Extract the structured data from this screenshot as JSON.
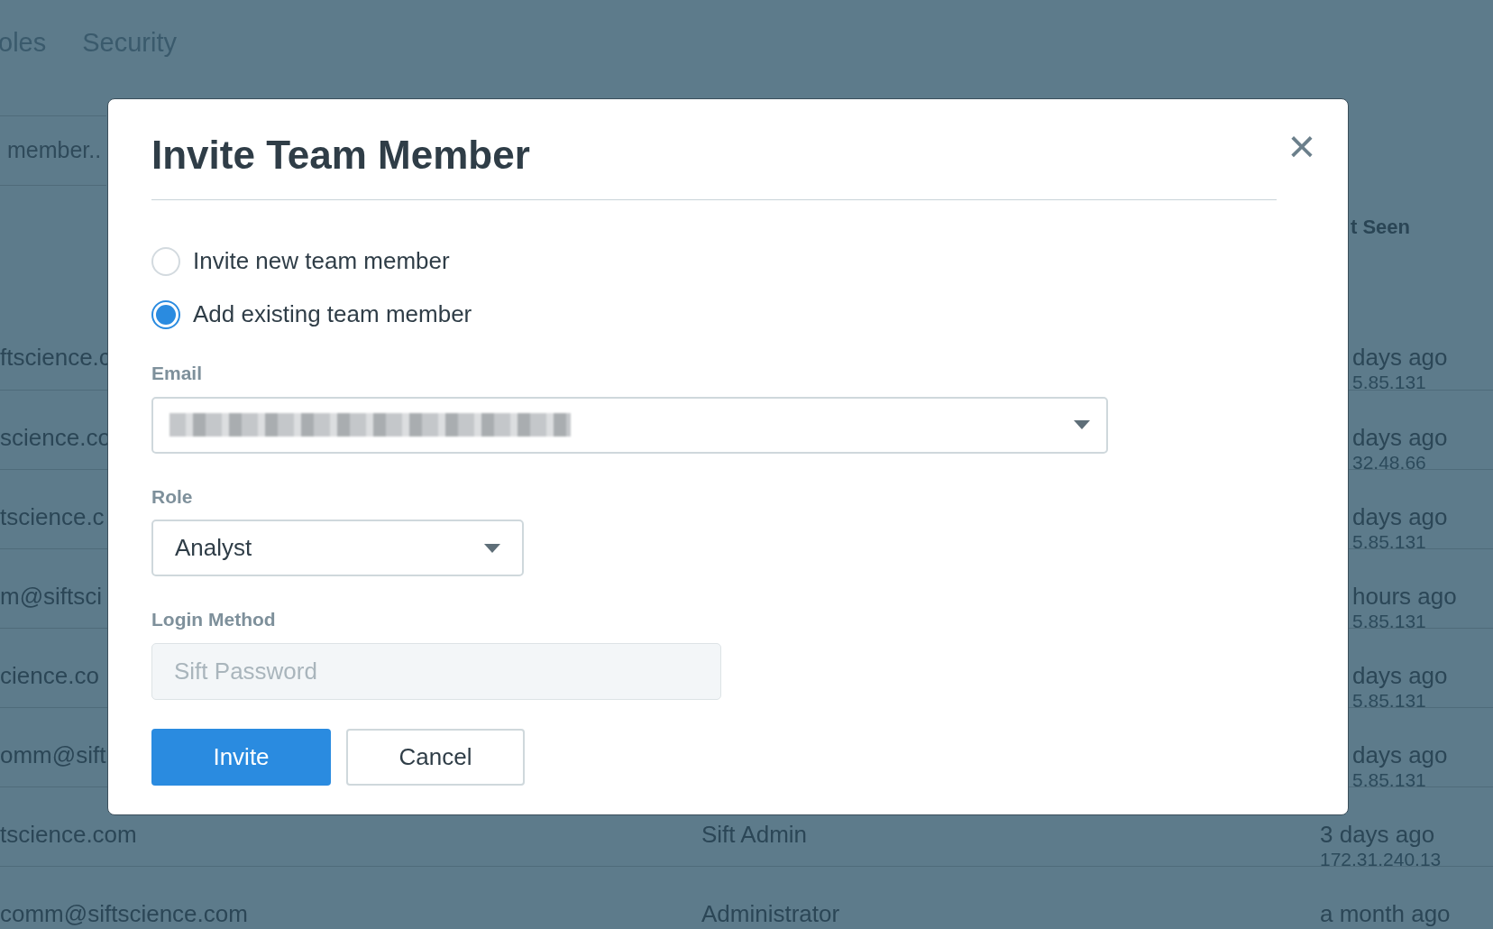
{
  "background": {
    "tabs": [
      "oles",
      "Security"
    ],
    "search": {
      "placeholder": "member.."
    },
    "table": {
      "column_3_header": "t Seen",
      "rows": [
        {
          "column_1": "ftscience.c",
          "column_3": "days ago",
          "column_3_sub": "5.85.131"
        },
        {
          "column_1": "science.co",
          "column_3": "days ago",
          "column_3_sub": "32.48.66"
        },
        {
          "column_1": "tscience.c",
          "column_3": "days ago",
          "column_3_sub": "5.85.131"
        },
        {
          "column_1": "m@siftsci",
          "column_3": "hours ago",
          "column_3_sub": "5.85.131"
        },
        {
          "column_1": "cience.co",
          "column_3": "days ago",
          "column_3_sub": "5.85.131"
        },
        {
          "column_1": "omm@sift",
          "column_3": "days ago",
          "column_3_sub": "5.85.131"
        },
        {
          "column_1": "tscience.com",
          "column_2": "Sift Admin",
          "column_3": "3 days ago",
          "column_3_sub": "172.31.240.13"
        },
        {
          "column_1": "comm@siftscience.com",
          "column_2": "Administrator",
          "column_3": "a month ago"
        }
      ]
    }
  },
  "dialog": {
    "title": "Invite Team Member",
    "close": "×",
    "options": [
      {
        "label": "Invite new team member",
        "selected": false
      },
      {
        "label": "Add existing team member",
        "selected": true
      }
    ],
    "email": {
      "label": "Email",
      "redacted": true
    },
    "role": {
      "label": "Role",
      "value": "Analyst"
    },
    "login_method": {
      "label": "Login Method",
      "placeholder": "Sift Password",
      "disabled": true
    },
    "buttons": [
      {
        "label": "Invite",
        "kind": "primary"
      },
      {
        "label": "Cancel",
        "kind": "secondary"
      }
    ]
  }
}
